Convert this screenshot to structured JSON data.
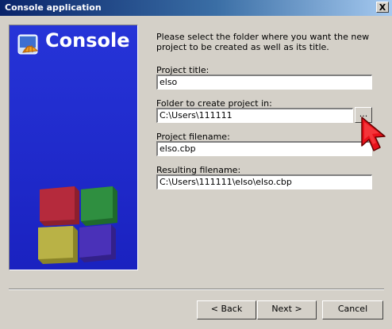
{
  "window": {
    "title": "Console application",
    "close_glyph": "X"
  },
  "banner": {
    "title": "Console",
    "logo_icon": "codeblocks-shell-icon",
    "cube_colors": [
      "#b02a3a",
      "#2e8a3e",
      "#b8b040",
      "#4a2fb0"
    ]
  },
  "instructions": "Please select the folder where you want the new project to be created as well as its title.",
  "form": {
    "project_title_label": "Project title:",
    "project_title_value": "elso",
    "folder_label": "Folder to create project in:",
    "folder_value": "C:\\Users\\111111",
    "browse_label": "...",
    "filename_label": "Project filename:",
    "filename_value": "elso.cbp",
    "resulting_label": "Resulting filename:",
    "resulting_value": "C:\\Users\\111111\\elso\\elso.cbp"
  },
  "buttons": {
    "back": "< Back",
    "next": "Next >",
    "cancel": "Cancel"
  },
  "colors": {
    "banner": "#1f2ed0",
    "face": "#d4d0c8",
    "cursor": "#e8101a"
  }
}
